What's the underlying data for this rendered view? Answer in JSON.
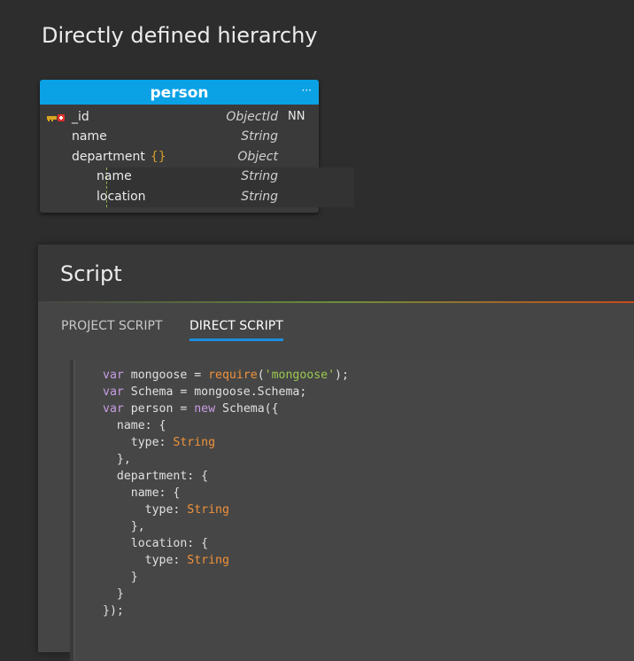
{
  "page": {
    "heading": "Directly defined hierarchy"
  },
  "entity": {
    "title": "person",
    "menu_icon": "···",
    "fields": [
      {
        "name": "_id",
        "type": "ObjectId",
        "nn": "NN"
      },
      {
        "name": "name",
        "type": "String"
      },
      {
        "name": "department",
        "brace": "{}",
        "type": "Object"
      },
      {
        "name": "name",
        "type": "String"
      },
      {
        "name": "location",
        "type": "String"
      }
    ],
    "colors": {
      "header": "#0aa1e5",
      "brace": "#d79d2c"
    }
  },
  "script": {
    "title": "Script",
    "tabs": [
      {
        "label": "PROJECT SCRIPT",
        "active": false
      },
      {
        "label": "DIRECT SCRIPT",
        "active": true
      }
    ],
    "code_lines": [
      "var mongoose = require('mongoose');",
      "var Schema = mongoose.Schema;",
      "var person = new Schema({",
      "  name: {",
      "    type: String",
      "  },",
      "  department: {",
      "    name: {",
      "      type: String",
      "    },",
      "    location: {",
      "      type: String",
      "    }",
      "  }",
      "});"
    ]
  }
}
